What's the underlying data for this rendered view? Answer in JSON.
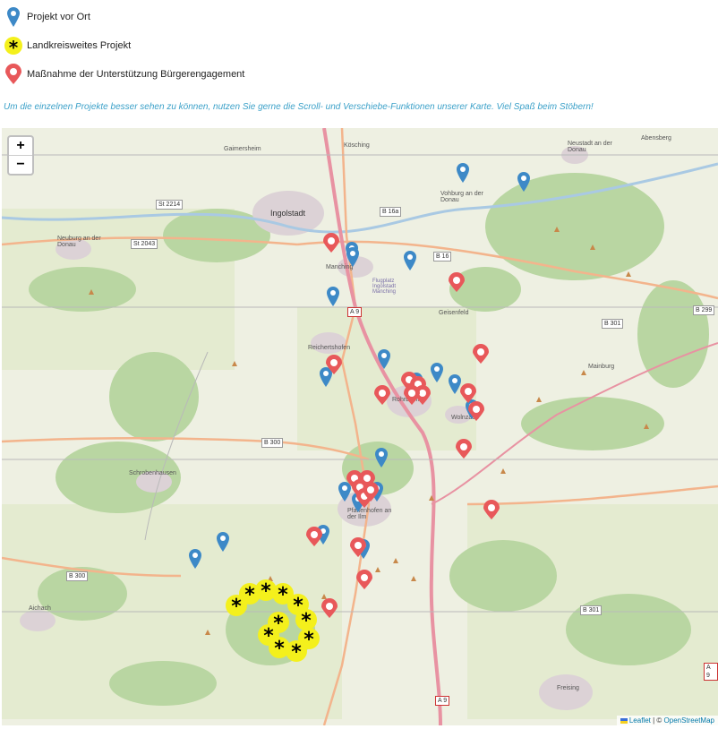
{
  "legend": {
    "blue_label": "Projekt vor Ort",
    "star_label": "Landkreisweites Projekt",
    "red_label": "Maßnahme der Unterstützung Bürgerengagement",
    "blue_color": "#3d89c7",
    "red_color": "#e8585a",
    "star_color": "#f4f01c"
  },
  "hint": "Um die einzelnen Projekte besser sehen zu können, nutzen Sie gerne die Scroll- und Verschiebe-Funktionen unserer Karte. Viel Spaß beim Stöbern!",
  "map": {
    "zoom_in": "+",
    "zoom_out": "−",
    "attribution_prefix": "Leaflet",
    "attribution_sep": " | © ",
    "attribution_osm": "OpenStreetMap",
    "places": [
      "Kösching",
      "Gaimersheim",
      "Neustadt an der Donau",
      "Abensberg",
      "Ingolstadt",
      "Vohburg an der Donau",
      "Neuburg an der Donau",
      "Manching",
      "Flugplatz Ingolstadt Manching",
      "Geisenfeld",
      "Reichertshofen",
      "Mainburg",
      "Rohrbach",
      "Wolnzach",
      "Schrobenhausen",
      "Pfaffenhofen an der Ilm",
      "Aichach",
      "Freising"
    ],
    "roads": [
      "St 2214",
      "B 16a",
      "B 16",
      "St 2043",
      "A 9",
      "B 301",
      "B 299",
      "B 300",
      "B 300",
      "B 301",
      "A 9",
      "A 9"
    ]
  }
}
